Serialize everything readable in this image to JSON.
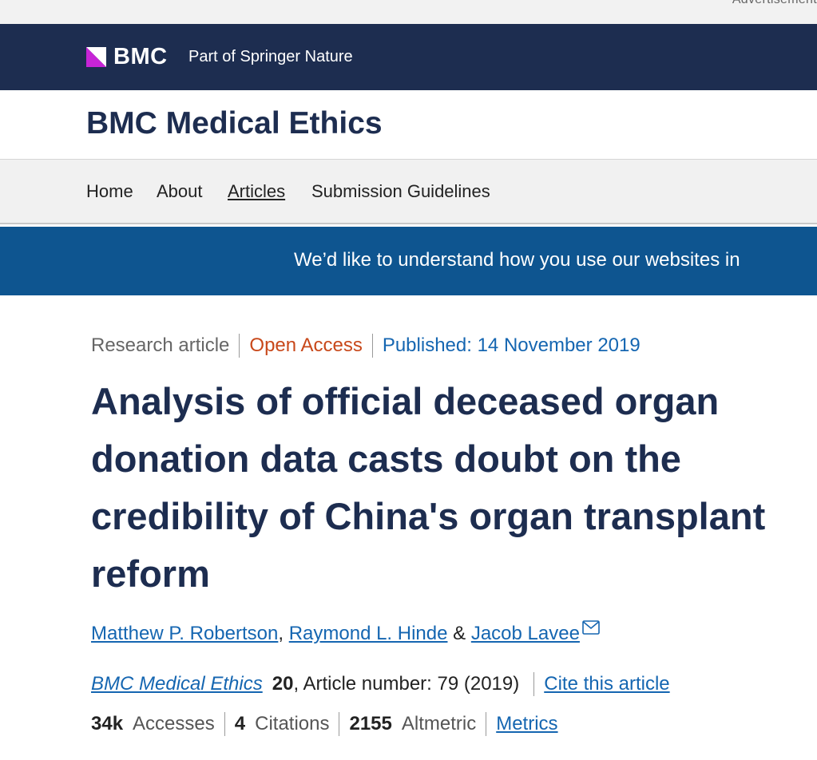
{
  "ad_strip": {
    "label": "Advertisement"
  },
  "brand": {
    "logo_text": "BMC",
    "tagline": "Part of Springer Nature",
    "logo_icon": "bmc-logo-mark",
    "colors": {
      "brand_navy": "#1d2d50",
      "logo_accent": "#c624d6"
    }
  },
  "journal": {
    "title": "BMC Medical Ethics"
  },
  "nav": {
    "items": [
      {
        "label": "Home"
      },
      {
        "label": "About"
      },
      {
        "label": "Articles",
        "active": true
      },
      {
        "label": "Submission Guidelines"
      }
    ]
  },
  "survey_banner": {
    "text": "We’d like to understand how you use our websites in",
    "color": "#0e5590"
  },
  "article": {
    "type": "Research article",
    "access": "Open Access",
    "published": "Published: 14 November 2019",
    "title": "Analysis of official deceased organ donation data casts doubt on the credibility of China's organ transplant reform",
    "authors": {
      "first": "Matthew P. Robertson",
      "comma": ", ",
      "second": "Raymond L. Hinde",
      "ampersand": " & ",
      "third": "Jacob Lavee",
      "third_icon": "mail-icon"
    },
    "citation": {
      "journal": "BMC Medical Ethics",
      "volume": "20",
      "details": ", Article number: 79 (2019)",
      "cite_label": "Cite this article"
    },
    "metrics": {
      "accesses_value": "34k",
      "accesses_label": "Accesses",
      "citations_value": "4",
      "citations_label": "Citations",
      "altmetric_value": "2155",
      "altmetric_label": "Altmetric",
      "metrics_link": "Metrics"
    },
    "colors": {
      "link_blue": "#1566b1",
      "open_access_orange": "#c8481a"
    }
  }
}
